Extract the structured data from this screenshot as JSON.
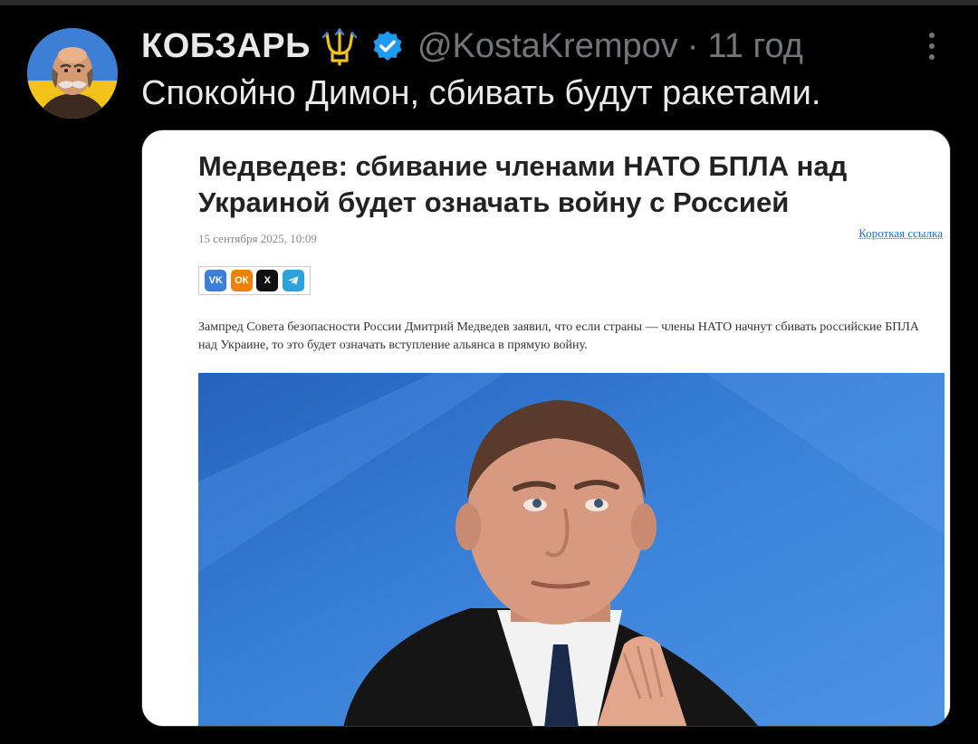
{
  "post": {
    "author_name": "КОБЗАРЬ",
    "name_emoji_icon": "trident-icon",
    "verified_icon": "verified-badge-icon",
    "handle": "@KostaKrempov",
    "separator": "·",
    "time": "11 год",
    "text": "Спокойно Димон, сбивать будут ракетами.",
    "more_icon": "more-vertical-icon"
  },
  "media": {
    "headline": "Медведев: сбивание членами НАТО БПЛА над Украиной будет означать войну с Россией",
    "date": "15 сентября 2025, 10:09",
    "short_link": "Короткая ссылка",
    "share_buttons": [
      {
        "icon": "vk-icon",
        "label": "VK"
      },
      {
        "icon": "odnoklassniki-icon",
        "label": "ОК"
      },
      {
        "icon": "x-icon",
        "label": "X"
      },
      {
        "icon": "telegram-icon",
        "label": ""
      }
    ],
    "lead": "Зампред Совета безопасности России Дмитрий Медведев заявил, что если страны — члены НАТО начнут сбивать российские БПЛА над Украине, то это будет означать вступление альянса в прямую войну.",
    "photo_icon": "portrait-photo"
  },
  "colors": {
    "background": "#000000",
    "primary_text": "#e7e9ea",
    "secondary_text": "#71767b",
    "verified": "#1d9bf0",
    "link": "#2b6ec8"
  }
}
